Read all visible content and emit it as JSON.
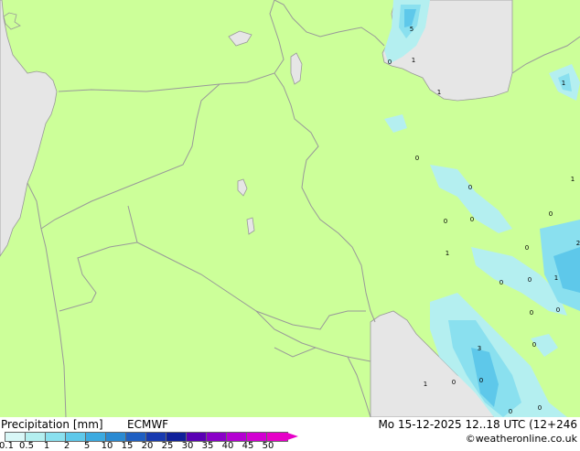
{
  "title_left": "Precipitation [mm]",
  "model": "ECMWF",
  "valid_time": "Mo 15-12-2025 12..18 UTC (12+246",
  "copyright": "©weatheronline.co.uk",
  "legend_ticks": [
    "0.1",
    "0.5",
    "1",
    "2",
    "5",
    "10",
    "15",
    "20",
    "25",
    "30",
    "35",
    "40",
    "45",
    "50"
  ],
  "legend_colors": [
    "#d9f7f7",
    "#b4eff0",
    "#8ae0ef",
    "#5ec8ea",
    "#3caae0",
    "#2a8ad2",
    "#1f5fc2",
    "#183ab0",
    "#10209a",
    "#5a00b4",
    "#8a00c8",
    "#b400d2",
    "#d200d2",
    "#e600c8"
  ],
  "colors": {
    "land": "#ccff99",
    "sea": "#e6e6e6",
    "border": "#999999",
    "precip_light": "#b4eff0",
    "precip_mid": "#8ae0ef",
    "precip_heavy": "#5ec8ea"
  },
  "value_labels": [
    "5",
    "0",
    "1",
    "1",
    "1",
    "0",
    "0",
    "0",
    "0",
    "0",
    "1",
    "0",
    "0",
    "0",
    "1",
    "0",
    "0",
    "2",
    "3",
    "0",
    "1",
    "0",
    "0",
    "0",
    "0",
    "1"
  ]
}
